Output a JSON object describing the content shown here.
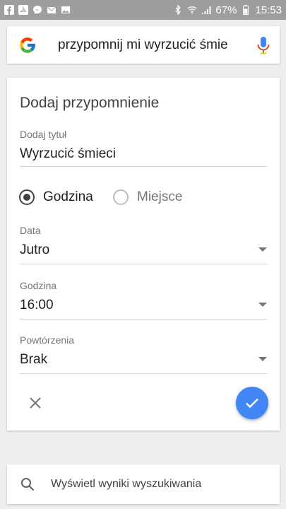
{
  "status_bar": {
    "icons_left": [
      "facebook-icon",
      "pdf-icon",
      "messenger-icon",
      "mail-icon",
      "image-icon"
    ],
    "battery": "67%",
    "time": "15:53"
  },
  "search": {
    "query": "przypomnij mi wyrzucić śmie"
  },
  "card": {
    "title": "Dodaj przypomnienie",
    "title_field": {
      "label": "Dodaj tytuł",
      "value": "Wyrzucić śmieci"
    },
    "radio_options": [
      {
        "label": "Godzina",
        "checked": true
      },
      {
        "label": "Miejsce",
        "checked": false
      }
    ],
    "date": {
      "label": "Data",
      "value": "Jutro"
    },
    "time": {
      "label": "Godzina",
      "value": "16:00"
    },
    "repeat": {
      "label": "Powtórzenia",
      "value": "Brak"
    }
  },
  "bottom": {
    "label": "Wyświetl wyniki wyszukiwania"
  },
  "colors": {
    "accent": "#4285f4",
    "status_bar": "#9e9e9e",
    "background": "#eeeeee"
  }
}
